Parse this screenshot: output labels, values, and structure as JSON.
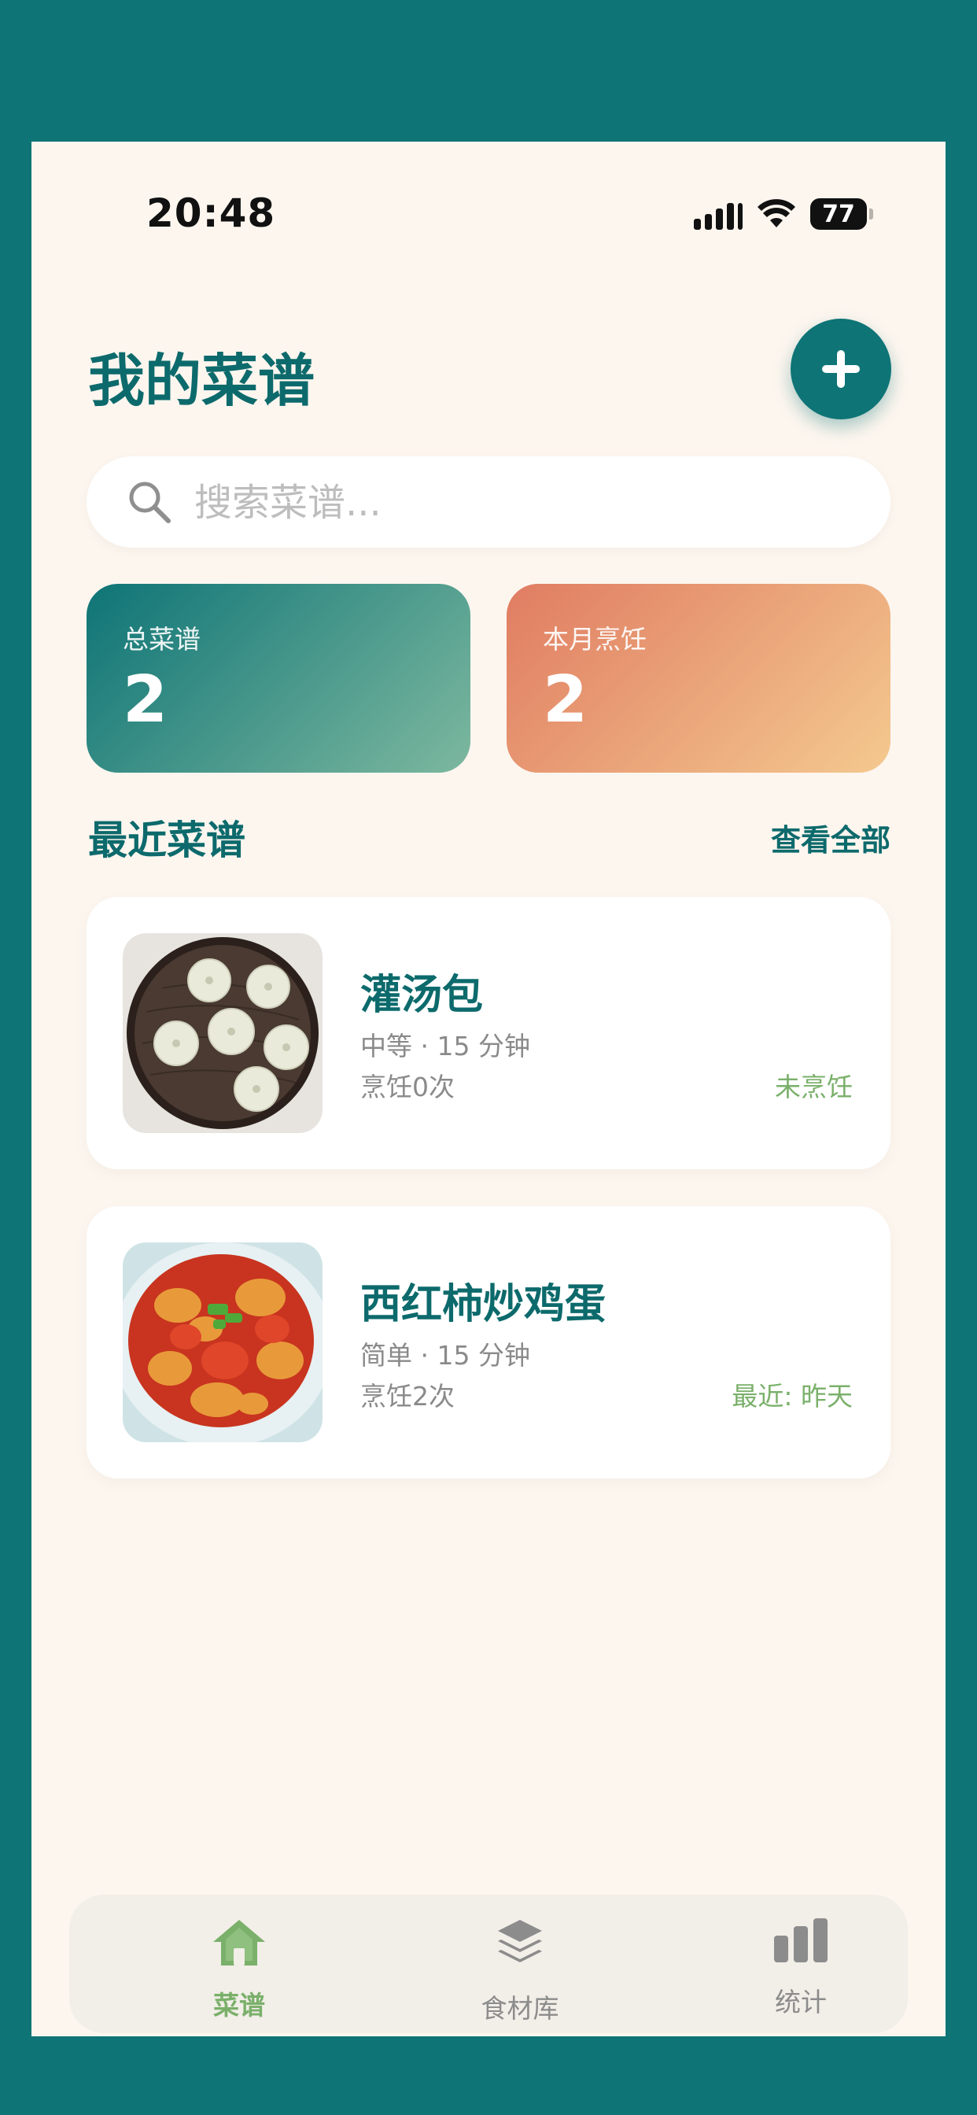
{
  "status_bar": {
    "time": "20:48",
    "battery": "77"
  },
  "header": {
    "title": "我的菜谱",
    "add_icon": "plus-icon"
  },
  "search": {
    "placeholder": "搜索菜谱...",
    "value": "",
    "icon": "search-icon"
  },
  "stats": [
    {
      "label": "总菜谱",
      "value": "2"
    },
    {
      "label": "本月烹饪",
      "value": "2"
    }
  ],
  "recent": {
    "title": "最近菜谱",
    "view_all": "查看全部",
    "items": [
      {
        "name": "灌汤包",
        "meta": "中等 · 15 分钟",
        "count": "烹饪0次",
        "status": "未烹饪"
      },
      {
        "name": "西红柿炒鸡蛋",
        "meta": "简单 · 15 分钟",
        "count": "烹饪2次",
        "status": "最近: 昨天"
      }
    ]
  },
  "tabs": [
    {
      "label": "菜谱",
      "icon": "home-icon",
      "active": true
    },
    {
      "label": "食材库",
      "icon": "layers-icon",
      "active": false
    },
    {
      "label": "统计",
      "icon": "bar-chart-icon",
      "active": false
    }
  ],
  "colors": {
    "primary": "#0e7476",
    "accent_green": "#7ab06a",
    "background": "#fdf6ef",
    "card_teal": "#0e7476",
    "card_orange": "#e07c62"
  }
}
